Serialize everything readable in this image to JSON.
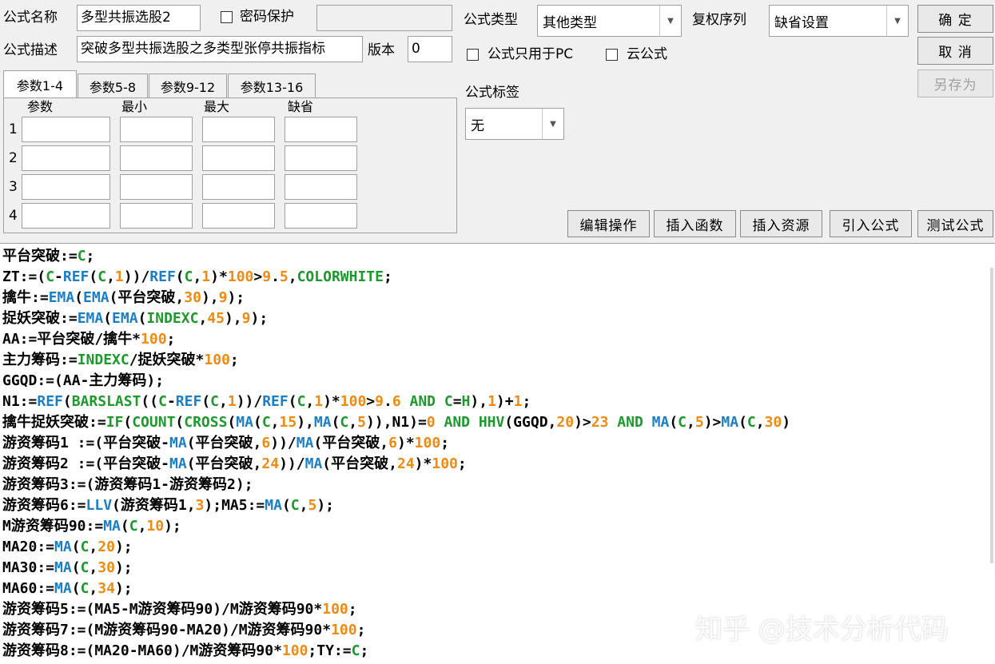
{
  "form": {
    "name_label": "公式名称",
    "name_value": "多型共振选股2",
    "password_label": "密码保护",
    "desc_label": "公式描述",
    "desc_value": "突破多型共振选股之多类型张停共振指标",
    "version_label": "版本",
    "version_value": "0",
    "type_label": "公式类型",
    "type_value": "其他类型",
    "rights_label": "复权序列",
    "rights_value": "缺省设置",
    "pc_only_label": "公式只用于PC",
    "cloud_label": "云公式",
    "tag_label": "公式标签",
    "tag_value": "无"
  },
  "buttons": {
    "ok": "确 定",
    "cancel": "取 消",
    "save_as": "另存为",
    "edit_ops": "编辑操作",
    "insert_func": "插入函数",
    "insert_res": "插入资源",
    "import_formula": "引入公式",
    "test_formula": "测试公式"
  },
  "params": {
    "tabs": [
      "参数1-4",
      "参数5-8",
      "参数9-12",
      "参数13-16"
    ],
    "headers": [
      "参数",
      "最小",
      "最大",
      "缺省"
    ],
    "rows": [
      "1",
      "2",
      "3",
      "4"
    ]
  },
  "code_lines": [
    [
      [
        "平台突破:=",
        ""
      ],
      [
        "C",
        "g"
      ],
      [
        ";",
        ""
      ]
    ],
    [
      [
        "ZT:=(",
        ""
      ],
      [
        "C",
        "g"
      ],
      [
        "-",
        ""
      ],
      [
        "REF",
        "b"
      ],
      [
        "(",
        ""
      ],
      [
        "C",
        "g"
      ],
      [
        ",",
        ""
      ],
      [
        "1",
        "o"
      ],
      [
        "))/",
        ""
      ],
      [
        "REF",
        "b"
      ],
      [
        "(",
        ""
      ],
      [
        "C",
        "g"
      ],
      [
        ",",
        ""
      ],
      [
        "1",
        "o"
      ],
      [
        ")*",
        ""
      ],
      [
        "100",
        "o"
      ],
      [
        ">",
        ""
      ],
      [
        "9",
        "o"
      ],
      [
        ".",
        ""
      ],
      [
        "5",
        "o"
      ],
      [
        ",",
        ""
      ],
      [
        "COLORWHITE",
        "g"
      ],
      [
        ";",
        ""
      ]
    ],
    [
      [
        "擒牛:=",
        ""
      ],
      [
        "EMA",
        "b"
      ],
      [
        "(",
        ""
      ],
      [
        "EMA",
        "b"
      ],
      [
        "(平台突破,",
        ""
      ],
      [
        "30",
        "o"
      ],
      [
        "),",
        ""
      ],
      [
        "9",
        "o"
      ],
      [
        ");",
        ""
      ]
    ],
    [
      [
        "捉妖突破:=",
        ""
      ],
      [
        "EMA",
        "b"
      ],
      [
        "(",
        ""
      ],
      [
        "EMA",
        "b"
      ],
      [
        "(",
        ""
      ],
      [
        "INDEXC",
        "g"
      ],
      [
        ",",
        ""
      ],
      [
        "45",
        "o"
      ],
      [
        "),",
        ""
      ],
      [
        "9",
        "o"
      ],
      [
        ");",
        ""
      ]
    ],
    [
      [
        "AA:=平台突破/擒牛*",
        ""
      ],
      [
        "100",
        "o"
      ],
      [
        ";",
        ""
      ]
    ],
    [
      [
        "主力筹码:=",
        ""
      ],
      [
        "INDEXC",
        "g"
      ],
      [
        "/捉妖突破*",
        ""
      ],
      [
        "100",
        "o"
      ],
      [
        ";",
        ""
      ]
    ],
    [
      [
        "GGQD:=(AA-主力筹码);",
        ""
      ]
    ],
    [
      [
        "N1:=",
        ""
      ],
      [
        "REF",
        "b"
      ],
      [
        "(",
        ""
      ],
      [
        "BARSLAST",
        "g"
      ],
      [
        "((",
        ""
      ],
      [
        "C",
        "g"
      ],
      [
        "-",
        ""
      ],
      [
        "REF",
        "b"
      ],
      [
        "(",
        ""
      ],
      [
        "C",
        "g"
      ],
      [
        ",",
        ""
      ],
      [
        "1",
        "o"
      ],
      [
        "))/",
        ""
      ],
      [
        "REF",
        "b"
      ],
      [
        "(",
        ""
      ],
      [
        "C",
        "g"
      ],
      [
        ",",
        ""
      ],
      [
        "1",
        "o"
      ],
      [
        ")*",
        ""
      ],
      [
        "100",
        "o"
      ],
      [
        ">",
        ""
      ],
      [
        "9",
        "o"
      ],
      [
        ".",
        ""
      ],
      [
        "6",
        "o"
      ],
      [
        " AND ",
        "g"
      ],
      [
        "C",
        "g"
      ],
      [
        "=",
        ""
      ],
      [
        "H",
        "g"
      ],
      [
        "),",
        ""
      ],
      [
        "1",
        "o"
      ],
      [
        ")+",
        ""
      ],
      [
        "1",
        "o"
      ],
      [
        ";",
        ""
      ]
    ],
    [
      [
        "擒牛捉妖突破:=",
        ""
      ],
      [
        "IF",
        "g"
      ],
      [
        "(",
        ""
      ],
      [
        "COUNT",
        "g"
      ],
      [
        "(",
        ""
      ],
      [
        "CROSS",
        "g"
      ],
      [
        "(",
        ""
      ],
      [
        "MA",
        "b"
      ],
      [
        "(",
        ""
      ],
      [
        "C",
        "g"
      ],
      [
        ",",
        ""
      ],
      [
        "15",
        "o"
      ],
      [
        "),",
        ""
      ],
      [
        "MA",
        "b"
      ],
      [
        "(",
        ""
      ],
      [
        "C",
        "g"
      ],
      [
        ",",
        ""
      ],
      [
        "5",
        "o"
      ],
      [
        ")),N1)=",
        ""
      ],
      [
        "0",
        "o"
      ],
      [
        " AND ",
        "g"
      ],
      [
        "HHV",
        "g"
      ],
      [
        "(GGQD,",
        ""
      ],
      [
        "20",
        "o"
      ],
      [
        ")>",
        ""
      ],
      [
        "23",
        "o"
      ],
      [
        " AND ",
        "g"
      ],
      [
        "MA",
        "b"
      ],
      [
        "(",
        ""
      ],
      [
        "C",
        "g"
      ],
      [
        ",",
        ""
      ],
      [
        "5",
        "o"
      ],
      [
        ")>",
        ""
      ],
      [
        "MA",
        "b"
      ],
      [
        "(",
        ""
      ],
      [
        "C",
        "g"
      ],
      [
        ",",
        ""
      ],
      [
        "30",
        "o"
      ],
      [
        ")",
        ""
      ]
    ],
    [
      [
        "游资筹码1 :=(平台突破-",
        ""
      ],
      [
        "MA",
        "b"
      ],
      [
        "(平台突破,",
        ""
      ],
      [
        "6",
        "o"
      ],
      [
        "))/",
        ""
      ],
      [
        "MA",
        "b"
      ],
      [
        "(平台突破,",
        ""
      ],
      [
        "6",
        "o"
      ],
      [
        ")*",
        ""
      ],
      [
        "100",
        "o"
      ],
      [
        ";",
        ""
      ]
    ],
    [
      [
        "游资筹码2 :=(平台突破-",
        ""
      ],
      [
        "MA",
        "b"
      ],
      [
        "(平台突破,",
        ""
      ],
      [
        "24",
        "o"
      ],
      [
        "))/",
        ""
      ],
      [
        "MA",
        "b"
      ],
      [
        "(平台突破,",
        ""
      ],
      [
        "24",
        "o"
      ],
      [
        ")*",
        ""
      ],
      [
        "100",
        "o"
      ],
      [
        ";",
        ""
      ]
    ],
    [
      [
        "游资筹码3:=(游资筹码1-游资筹码2);",
        ""
      ]
    ],
    [
      [
        "游资筹码6:=",
        ""
      ],
      [
        "LLV",
        "b"
      ],
      [
        "(游资筹码1,",
        ""
      ],
      [
        "3",
        "o"
      ],
      [
        ");MA5:=",
        ""
      ],
      [
        "MA",
        "b"
      ],
      [
        "(",
        ""
      ],
      [
        "C",
        "g"
      ],
      [
        ",",
        ""
      ],
      [
        "5",
        "o"
      ],
      [
        ");",
        ""
      ]
    ],
    [
      [
        "M游资筹码90:=",
        ""
      ],
      [
        "MA",
        "b"
      ],
      [
        "(",
        ""
      ],
      [
        "C",
        "g"
      ],
      [
        ",",
        ""
      ],
      [
        "10",
        "o"
      ],
      [
        ");",
        ""
      ]
    ],
    [
      [
        "MA20:=",
        ""
      ],
      [
        "MA",
        "b"
      ],
      [
        "(",
        ""
      ],
      [
        "C",
        "g"
      ],
      [
        ",",
        ""
      ],
      [
        "20",
        "o"
      ],
      [
        ");",
        ""
      ]
    ],
    [
      [
        "MA30:=",
        ""
      ],
      [
        "MA",
        "b"
      ],
      [
        "(",
        ""
      ],
      [
        "C",
        "g"
      ],
      [
        ",",
        ""
      ],
      [
        "30",
        "o"
      ],
      [
        ");",
        ""
      ]
    ],
    [
      [
        "MA60:=",
        ""
      ],
      [
        "MA",
        "b"
      ],
      [
        "(",
        ""
      ],
      [
        "C",
        "g"
      ],
      [
        ",",
        ""
      ],
      [
        "34",
        "o"
      ],
      [
        ");",
        ""
      ]
    ],
    [
      [
        "游资筹码5:=(MA5-M游资筹码90)/M游资筹码90*",
        ""
      ],
      [
        "100",
        "o"
      ],
      [
        ";",
        ""
      ]
    ],
    [
      [
        "游资筹码7:=(M游资筹码90-MA20)/M游资筹码90*",
        ""
      ],
      [
        "100",
        "o"
      ],
      [
        ";",
        ""
      ]
    ],
    [
      [
        "游资筹码8:=(MA20-MA60)/M游资筹码90*",
        ""
      ],
      [
        "100",
        "o"
      ],
      [
        ";TY:=",
        ""
      ],
      [
        "C",
        "g"
      ],
      [
        ";",
        ""
      ]
    ]
  ],
  "watermark": "知乎 @技术分析代码"
}
